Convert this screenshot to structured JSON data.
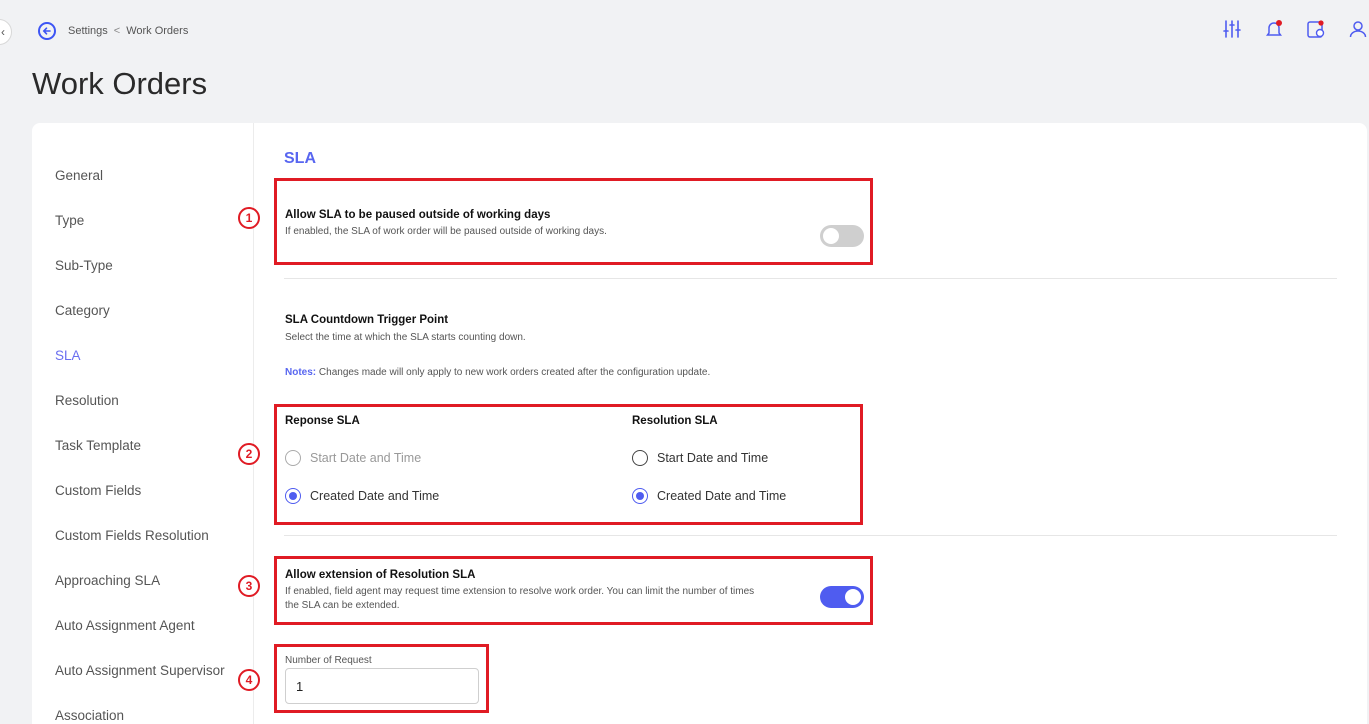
{
  "breadcrumb": {
    "parent": "Settings",
    "separator": "<",
    "current": "Work Orders"
  },
  "page_title": "Work Orders",
  "top_icons": [
    "sliders-icon",
    "bell-icon",
    "calendar-settings-icon",
    "user-icon"
  ],
  "sidebar": {
    "items": [
      {
        "label": "General"
      },
      {
        "label": "Type"
      },
      {
        "label": "Sub-Type"
      },
      {
        "label": "Category"
      },
      {
        "label": "SLA",
        "active": true
      },
      {
        "label": "Resolution"
      },
      {
        "label": "Task Template"
      },
      {
        "label": "Custom Fields"
      },
      {
        "label": "Custom Fields Resolution"
      },
      {
        "label": "Approaching SLA"
      },
      {
        "label": "Auto Assignment Agent"
      },
      {
        "label": "Auto Assignment Supervisor"
      },
      {
        "label": "Association"
      }
    ]
  },
  "section": {
    "title": "SLA",
    "pause_option": {
      "badge": "1",
      "title": "Allow SLA to be paused outside of working days",
      "description": "If enabled, the SLA of work order will be paused outside of working days.",
      "enabled": false
    },
    "countdown": {
      "title": "SLA Countdown Trigger Point",
      "description": "Select the time at which the SLA starts counting down.",
      "notes_label": "Notes:",
      "notes_text": "Changes made will only apply to new work orders created after the configuration update."
    },
    "trigger_options": {
      "badge": "2",
      "response": {
        "title": "Reponse SLA",
        "options": [
          "Start Date and Time",
          "Created Date and Time"
        ],
        "selected": "Created Date and Time"
      },
      "resolution": {
        "title": "Resolution SLA",
        "options": [
          "Start Date and Time",
          "Created Date and Time"
        ],
        "selected": "Created Date and Time"
      }
    },
    "extension_option": {
      "badge": "3",
      "title": "Allow extension of Resolution SLA",
      "description_line1": "If enabled, field agent may request time extension to resolve work order. You can limit the number of times",
      "description_line2": "the SLA can be extended.",
      "enabled": true
    },
    "request_count": {
      "badge": "4",
      "label": "Number of Request",
      "value": "1"
    }
  },
  "colors": {
    "accent": "#4f5cf0",
    "highlight": "#e01b24"
  }
}
